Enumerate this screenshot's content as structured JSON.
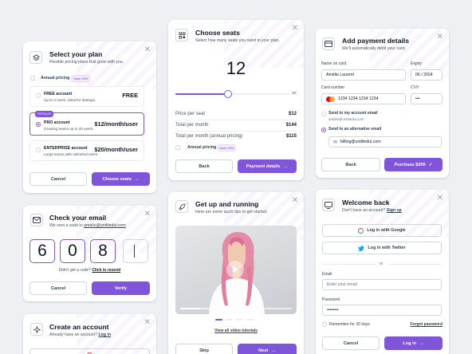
{
  "plan_card": {
    "title": "Select your plan",
    "subtitle": "Flexible pricing plans that grow with you.",
    "annual_label": "Annual pricing",
    "annual_badge": "Save 20%",
    "plans": [
      {
        "name": "FREE account",
        "desc": "Up to 3 users. Ideal for startups.",
        "price": "FREE"
      },
      {
        "name": "PRO account",
        "desc": "Growing teams up to 20 users.",
        "price": "$12/month/user",
        "badge": "POPULAR"
      },
      {
        "name": "ENTERPRISE account",
        "desc": "Large teams with unlimited users.",
        "price": "$20/month/user"
      }
    ],
    "cancel": "Cancel",
    "choose": "Choose seats"
  },
  "seats_card": {
    "title": "Choose seats",
    "subtitle": "Select how many seats you need in your plan.",
    "count": "12",
    "slider_level": 0.46,
    "infinity": "∞",
    "rows": [
      {
        "label": "Price per seat",
        "value": "$12"
      },
      {
        "label": "Total per month",
        "value": "$144"
      },
      {
        "label": "Total per month (annual pricing)",
        "value": "$115"
      }
    ],
    "annual_label": "Annual pricing",
    "annual_badge": "Save 20%",
    "back": "Back",
    "next": "Payment details"
  },
  "payment_card": {
    "title": "Add payment details",
    "subtitle": "We'll automatically debit your card.",
    "name_label": "Name on card",
    "name_value": "Amélie Laurent",
    "expiry_label": "Expiry",
    "expiry_value": "06 / 2024",
    "card_label": "Card number",
    "card_value": "1234 1234 1234 1234",
    "cvv_label": "CVV",
    "cvv_value": "•••",
    "opt1_label": "Send to my account email",
    "opt1_email": "amelie@untitledui.com",
    "opt2_label": "Send to an alternative email",
    "alt_email": "billing@untitledui.com",
    "back": "Back",
    "purchase": "Purchase $200"
  },
  "email_card": {
    "title": "Check your email",
    "subtitle_prefix": "We sent a code to ",
    "subtitle_email": "amelie@untitledui.com",
    "digits": [
      "6",
      "0",
      "8",
      ""
    ],
    "resend_prefix": "Didn't get a code? ",
    "resend_link": "Click to resend",
    "cancel": "Cancel",
    "verify": "Verify"
  },
  "account_card": {
    "title": "Create an account",
    "subtitle_prefix": "Already have an account? ",
    "subtitle_link": "Log in"
  },
  "video_card": {
    "title": "Get up and running",
    "subtitle": "Here are some quick tips to get started.",
    "link": "View all video tutorials",
    "skip": "Skip",
    "next": "Next"
  },
  "welcome_card": {
    "title": "Welcome back",
    "subtitle_prefix": "Don't have an account? ",
    "subtitle_link": "Sign up",
    "google": "Log in with Google",
    "twitter": "Log in with Twitter",
    "or": "or",
    "email_label": "Email",
    "email_placeholder": "Enter your email",
    "password_label": "Password",
    "password_value": "••••••••",
    "remember": "Remember for 30 days",
    "forgot": "Forgot password",
    "cancel": "Cancel",
    "login": "Log in"
  },
  "colors": {
    "accent": "#7f56d9",
    "background": "#eef0f4",
    "border": "#d0d5dd"
  }
}
